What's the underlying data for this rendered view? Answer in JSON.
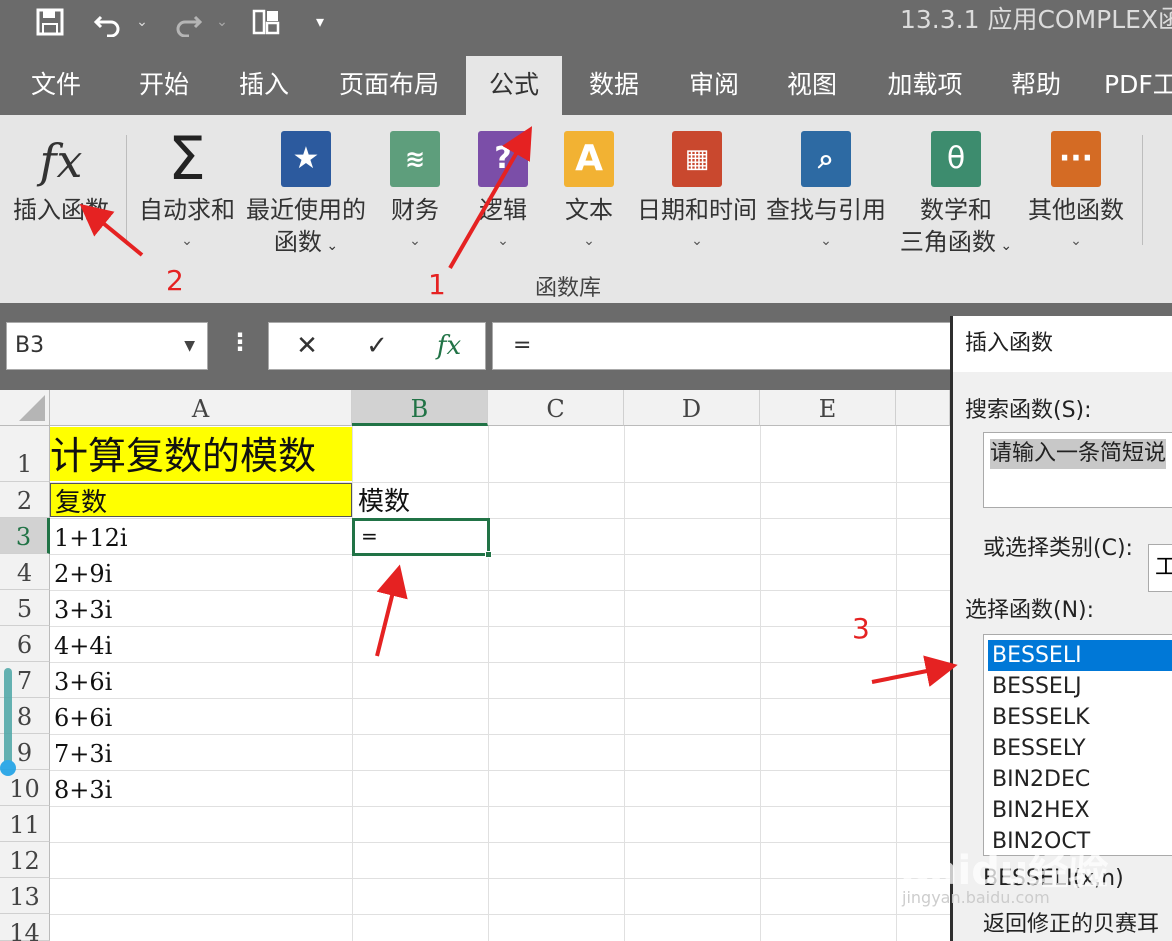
{
  "window": {
    "title": "13.3.1   应用COMPLEX函"
  },
  "quick_access": {
    "save_icon": "save-icon",
    "undo_icon": "undo-icon",
    "redo_icon": "redo-icon",
    "layout_icon": "layout-icon",
    "customize_icon": "customize-icon"
  },
  "tabs": [
    "文件",
    "开始",
    "插入",
    "页面布局",
    "公式",
    "数据",
    "审阅",
    "视图",
    "加载项",
    "帮助",
    "PDF工"
  ],
  "active_tab": "公式",
  "ribbon": {
    "insert_function": {
      "icon": "fx",
      "label": "插入函数"
    },
    "autosum": {
      "icon": "Σ",
      "label": "自动求和"
    },
    "recent": {
      "label1": "最近使用的",
      "label2": "函数"
    },
    "financial": {
      "label": "财务"
    },
    "logical": {
      "label": "逻辑"
    },
    "text": {
      "icon": "A",
      "label": "文本"
    },
    "datetime": {
      "label": "日期和时间"
    },
    "lookup": {
      "label": "查找与引用"
    },
    "math": {
      "icon": "θ",
      "label1": "数学和",
      "label2": "三角函数"
    },
    "other": {
      "icon": "···",
      "label": "其他函数"
    },
    "group_label": "函数库",
    "colors": {
      "finance": "#5e9e7c",
      "logical": "#7b4ea8",
      "text": "#f2b233",
      "datetime": "#c9482e",
      "lookup": "#2d6aa3",
      "math": "#3d8c6e",
      "other": "#d46b24",
      "recent": "#2c5a9e"
    }
  },
  "formula_bar": {
    "name_box": "B3",
    "cancel": "✕",
    "enter": "✓",
    "fx": "fx",
    "content": "="
  },
  "grid": {
    "columns": [
      "A",
      "B",
      "C",
      "D",
      "E"
    ],
    "rows": [
      "1",
      "2",
      "3",
      "4",
      "5",
      "6",
      "7",
      "8",
      "9",
      "10",
      "11",
      "12",
      "13",
      "14"
    ],
    "title": "计算复数的模数",
    "header_a": "复数",
    "header_b": "模数",
    "b3_value": "=",
    "complex_values": [
      "1+12i",
      "2+9i",
      "3+3i",
      "4+4i",
      "3+6i",
      "6+6i",
      "7+3i",
      "8+3i"
    ]
  },
  "dialog": {
    "title": "插入函数",
    "search_label": "搜索函数(S):",
    "search_placeholder": "请输入一条简短说",
    "category_label": "或选择类别(C):",
    "category_value": "工",
    "list_label": "选择函数(N):",
    "functions": [
      "BESSELI",
      "BESSELJ",
      "BESSELK",
      "BESSELY",
      "BIN2DEC",
      "BIN2HEX",
      "BIN2OCT"
    ],
    "selected_function": "BESSELI",
    "signature": "BESSELI(x,n)",
    "description": "返回修正的贝赛耳"
  },
  "annotations": [
    "1",
    "2",
    "3"
  ],
  "watermark": {
    "main": "Baidu经验",
    "sub": "jingyan.baidu.com"
  }
}
